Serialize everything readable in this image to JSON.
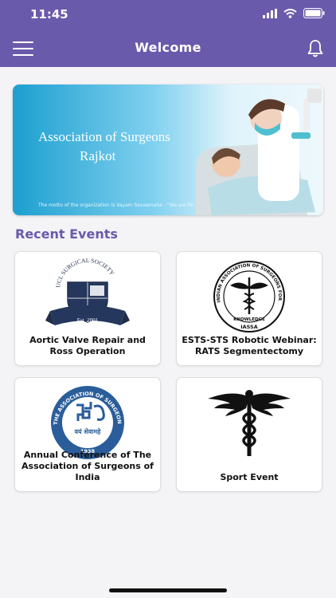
{
  "status_bar": {
    "time": "11:45"
  },
  "header": {
    "title": "Welcome"
  },
  "banner": {
    "line1": "Association of Surgeons",
    "line2": "Rajkot",
    "motto": "The motto of the organization is Vayam Sevaamahe - \"We are for service\""
  },
  "section": {
    "title": "Recent Events"
  },
  "events": [
    {
      "label": "Aortic Valve Repair and Ross Operation",
      "logo": "ucl-surgical-society-logo",
      "logo_text": "UCL SURGICAL SOCIETY",
      "logo_sub": "Est. 2001"
    },
    {
      "label": "ESTS-STS Robotic Webinar: RATS Segmentectomy",
      "logo": "iassa-logo",
      "logo_text": "INDIAN ASSOCIATION OF SURGEONS FOR SLEEP APNOEA",
      "logo_sub": "KNOWLEDGE",
      "logo_sub2": "IASSA"
    },
    {
      "label": "Annual Conference of The Association of Surgeons of India",
      "logo": "asi-logo",
      "logo_text": "THE ASSOCIATION OF SURGEONS OF INDIA",
      "logo_sub": "वयं सेवामहे",
      "logo_year": "1938"
    },
    {
      "label": "Sport Event",
      "logo": "caduceus-logo"
    }
  ],
  "colors": {
    "primary": "#6a5aab",
    "background": "#f4f3f6"
  }
}
